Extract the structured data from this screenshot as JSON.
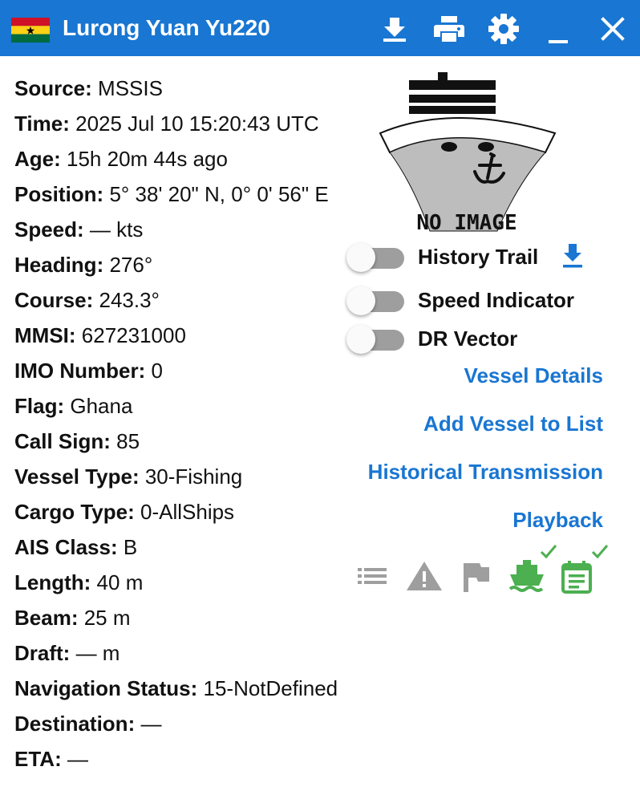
{
  "window": {
    "title": "Lurong Yuan Yu220",
    "flag_country": "Ghana",
    "buttons": {
      "download": "download-icon",
      "print": "print-icon",
      "settings": "gear-icon",
      "minimize": "minimize-icon",
      "close": "close-icon"
    },
    "accent_color": "#1976d2"
  },
  "details": [
    {
      "label": "Source:",
      "value": "MSSIS"
    },
    {
      "label": "Time:",
      "value": "2025 Jul 10 15:20:43 UTC"
    },
    {
      "label": "Age:",
      "value": "15h 20m 44s ago"
    },
    {
      "label": "Position:",
      "value": " 5° 38' 20\" N, 0° 0' 56\" E"
    },
    {
      "label": "Speed:",
      "value": "— kts"
    },
    {
      "label": "Heading:",
      "value": "276°"
    },
    {
      "label": "Course:",
      "value": "243.3°"
    },
    {
      "label": "MMSI:",
      "value": "627231000"
    },
    {
      "label": "IMO Number:",
      "value": "0"
    },
    {
      "label": "Flag:",
      "value": "Ghana"
    },
    {
      "label": "Call Sign:",
      "value": "85"
    },
    {
      "label": "Vessel Type:",
      "value": "30-Fishing"
    },
    {
      "label": "Cargo Type:",
      "value": "0-AllShips"
    },
    {
      "label": "AIS Class:",
      "value": "B"
    },
    {
      "label": "Length:",
      "value": "40 m"
    },
    {
      "label": "Beam:",
      "value": "25 m"
    },
    {
      "label": "Draft:",
      "value": "— m"
    },
    {
      "label": "Navigation Status:",
      "value": "15-NotDefined"
    },
    {
      "label": "Destination:",
      "value": "—"
    },
    {
      "label": "ETA:",
      "value": "—"
    }
  ],
  "image_placeholder": {
    "text": "NO IMAGE"
  },
  "toggles": [
    {
      "label": "History Trail",
      "on": false
    },
    {
      "label": "Speed Indicator",
      "on": false
    },
    {
      "label": "DR Vector",
      "on": false
    }
  ],
  "links": {
    "vessel_details": "Vessel Details",
    "add_to_list": "Add Vessel to List",
    "historical": "Historical Transmission",
    "playback": "Playback"
  },
  "actions": [
    {
      "icon": "list-icon",
      "color": "#9e9e9e",
      "checked": false
    },
    {
      "icon": "warning-icon",
      "color": "#9e9e9e",
      "checked": false
    },
    {
      "icon": "flag-icon",
      "color": "#9e9e9e",
      "checked": false
    },
    {
      "icon": "ship-icon",
      "color": "#4caf50",
      "checked": true
    },
    {
      "icon": "calendar-note-icon",
      "color": "#4caf50",
      "checked": true
    }
  ]
}
